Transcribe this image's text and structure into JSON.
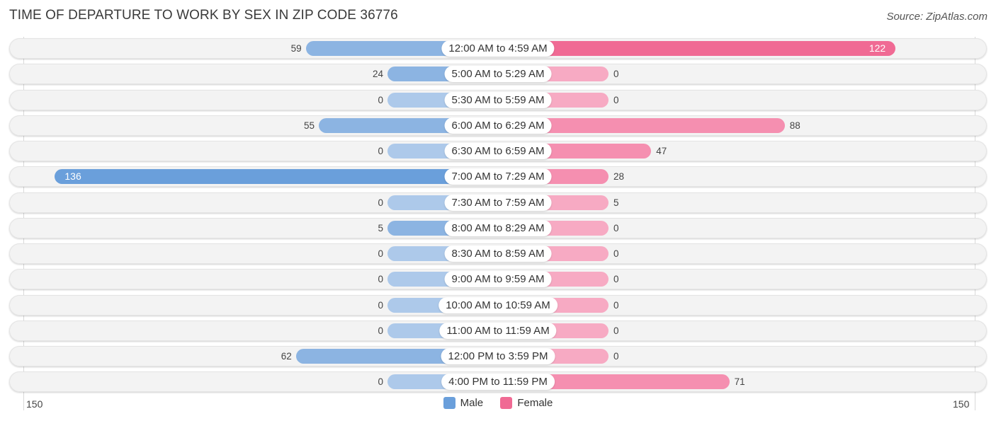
{
  "header": {
    "title": "TIME OF DEPARTURE TO WORK BY SEX IN ZIP CODE 36776",
    "source": "Source: ZipAtlas.com"
  },
  "legend": {
    "male_label": "Male",
    "female_label": "Female"
  },
  "colors": {
    "male": "#6a9fdb",
    "female": "#f06a94"
  },
  "axis": {
    "left_tick": "150",
    "right_tick": "150"
  },
  "chart_data": {
    "type": "bar",
    "orientation": "horizontal-diverging",
    "title": "TIME OF DEPARTURE TO WORK BY SEX IN ZIP CODE 36776",
    "xlabel": "",
    "ylabel": "",
    "xlim": [
      -150,
      150
    ],
    "legend_position": "bottom-center",
    "grid": false,
    "categories": [
      "12:00 AM to 4:59 AM",
      "5:00 AM to 5:29 AM",
      "5:30 AM to 5:59 AM",
      "6:00 AM to 6:29 AM",
      "6:30 AM to 6:59 AM",
      "7:00 AM to 7:29 AM",
      "7:30 AM to 7:59 AM",
      "8:00 AM to 8:29 AM",
      "8:30 AM to 8:59 AM",
      "9:00 AM to 9:59 AM",
      "10:00 AM to 10:59 AM",
      "11:00 AM to 11:59 AM",
      "12:00 PM to 3:59 PM",
      "4:00 PM to 11:59 PM"
    ],
    "series": [
      {
        "name": "Male",
        "values": [
          59,
          24,
          0,
          55,
          0,
          136,
          0,
          5,
          0,
          0,
          0,
          0,
          62,
          0
        ]
      },
      {
        "name": "Female",
        "values": [
          122,
          0,
          0,
          88,
          47,
          28,
          5,
          0,
          0,
          0,
          0,
          0,
          0,
          71
        ]
      }
    ]
  }
}
